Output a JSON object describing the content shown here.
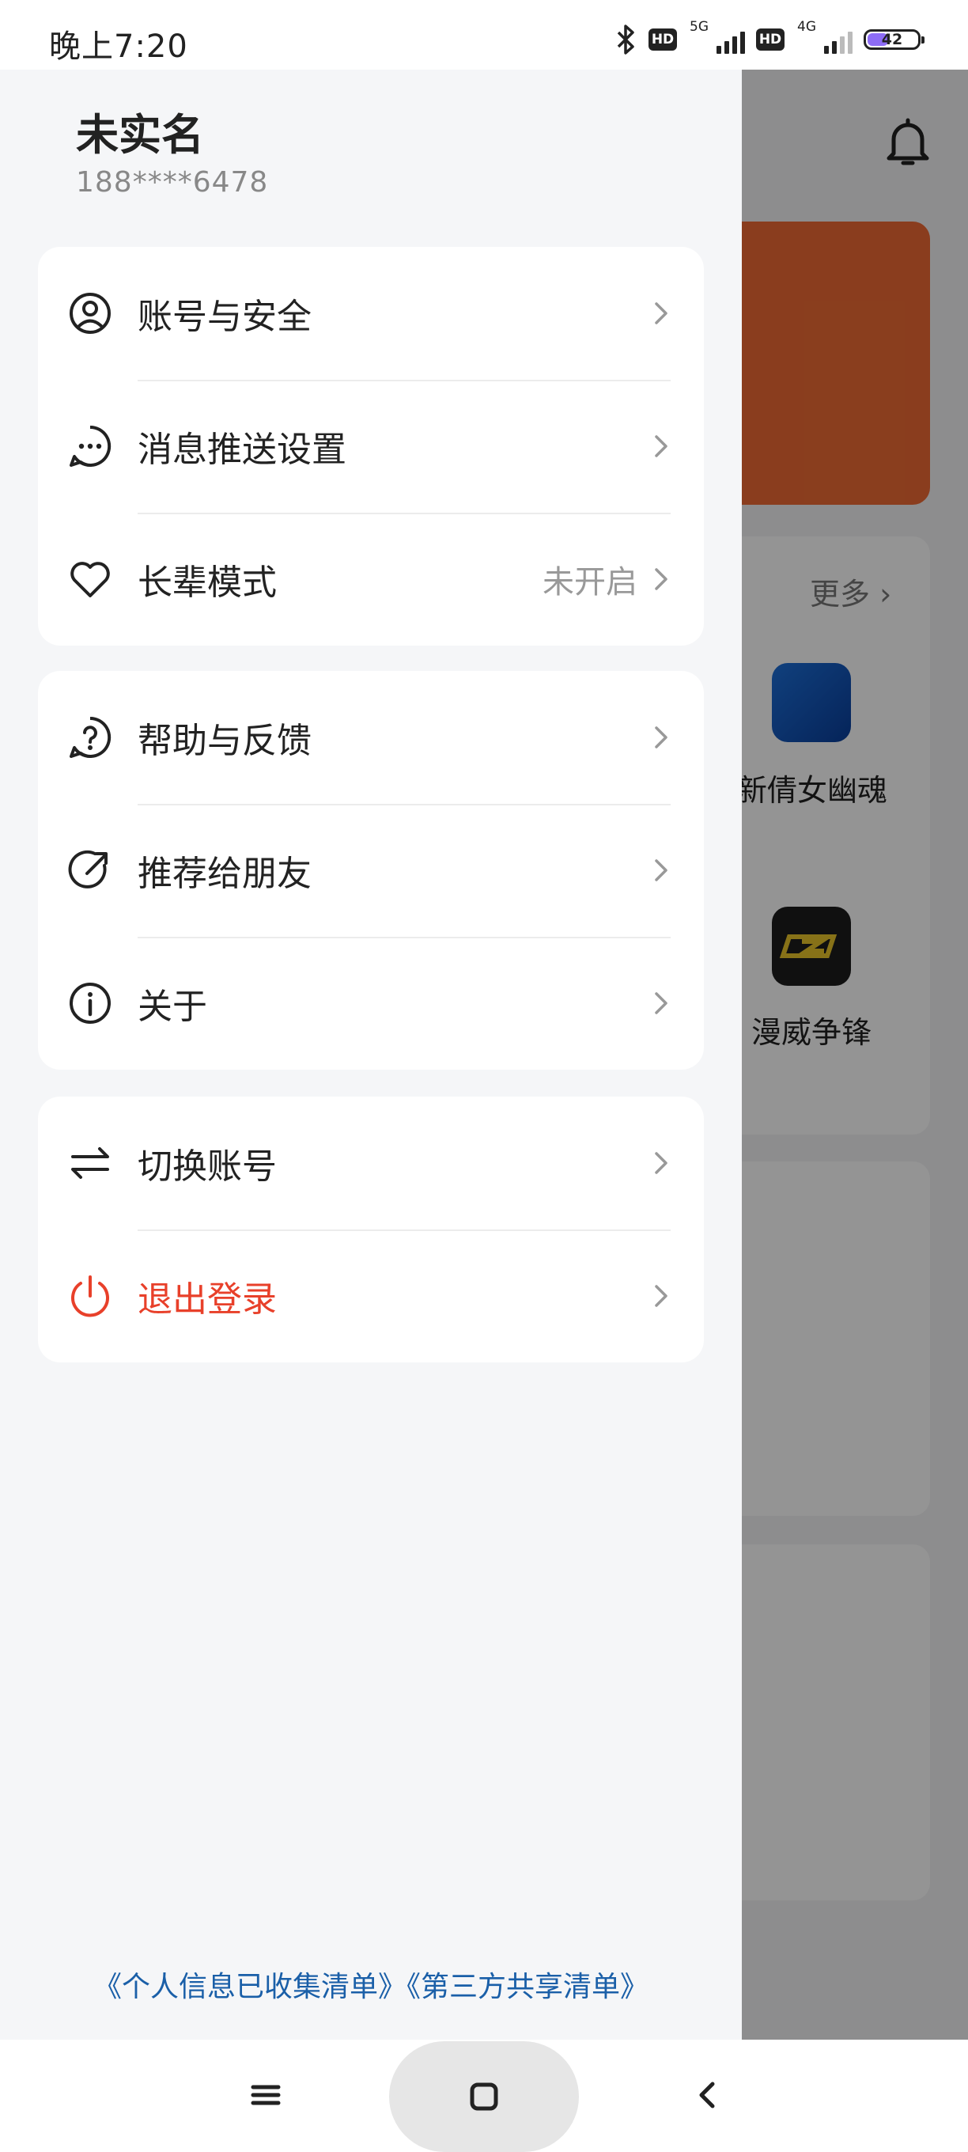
{
  "status_bar": {
    "time": "晚上7:20",
    "network_1": "5G",
    "network_2": "4G",
    "hd_label": "HD",
    "battery": "42",
    "icons": [
      "bluetooth-icon",
      "hd-icon",
      "signal-icon",
      "hd-icon",
      "signal-icon",
      "battery-icon"
    ]
  },
  "user": {
    "name": "未实名",
    "phone": "188****6478"
  },
  "groups": [
    {
      "items": [
        {
          "label": "账号与安全",
          "icon": "user-circle-icon",
          "value": ""
        },
        {
          "label": "消息推送设置",
          "icon": "message-icon",
          "value": ""
        },
        {
          "label": "长辈模式",
          "icon": "heart-icon",
          "value": "未开启"
        }
      ]
    },
    {
      "items": [
        {
          "label": "帮助与反馈",
          "icon": "help-icon",
          "value": ""
        },
        {
          "label": "推荐给朋友",
          "icon": "share-icon",
          "value": ""
        },
        {
          "label": "关于",
          "icon": "info-icon",
          "value": ""
        }
      ]
    },
    {
      "items": [
        {
          "label": "切换账号",
          "icon": "switch-icon",
          "value": ""
        },
        {
          "label": "退出登录",
          "icon": "power-icon",
          "value": ""
        }
      ]
    }
  ],
  "footer": {
    "link_1": "《个人信息已收集清单》",
    "link_2": "《第三方共享清单》"
  },
  "background": {
    "more_label": "更多",
    "game_1": "新倩女幽魂",
    "game_2": "漫威争锋"
  },
  "colors": {
    "accent_danger": "#e8402a",
    "link": "#1a5fa8",
    "banner": "#ee6a34",
    "drawer_bg": "#f5f6f8"
  }
}
